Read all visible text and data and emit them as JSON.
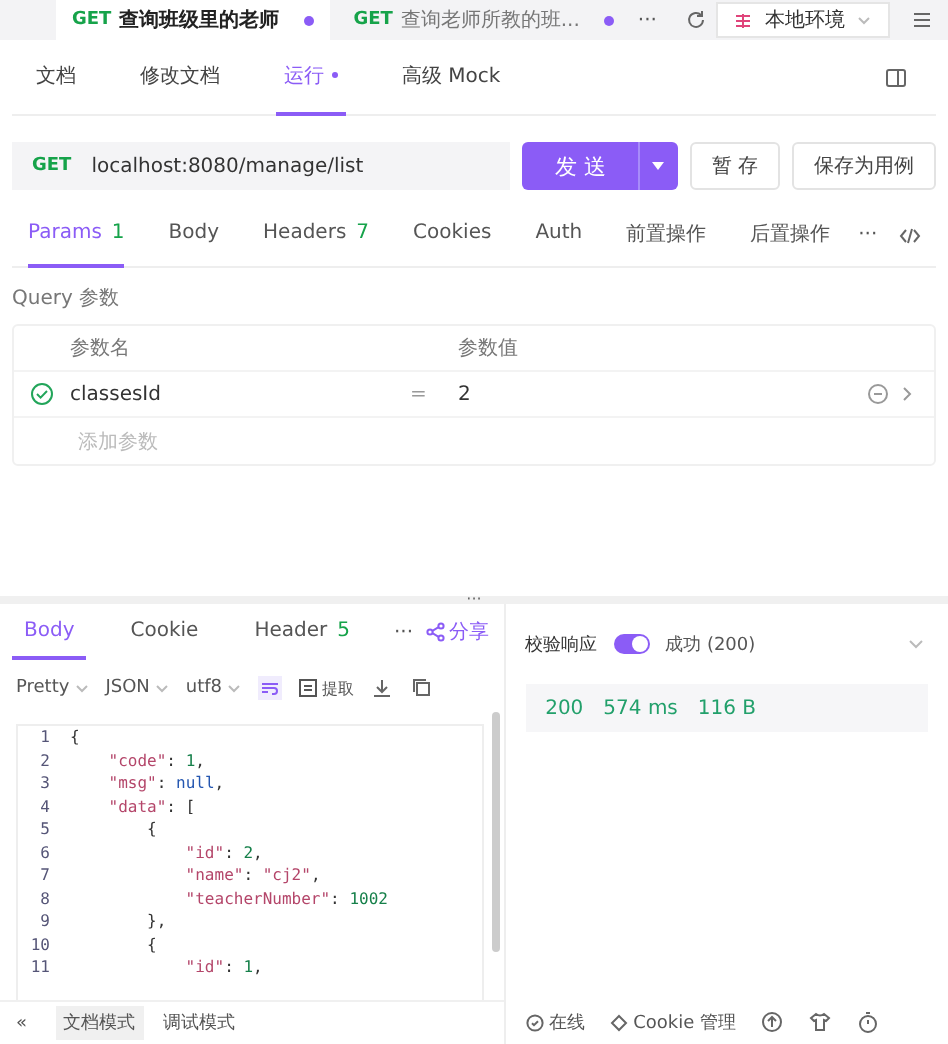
{
  "request_tabs": [
    {
      "method": "GET",
      "title": "查询班级里的老师",
      "selected": true
    },
    {
      "method": "GET",
      "title": "查询老师所教的班...",
      "selected": false
    }
  ],
  "tab_more": "···",
  "environment": "本地环境",
  "view_tabs": [
    {
      "text": "文档",
      "selected": false,
      "dot": false
    },
    {
      "text": "修改文档",
      "selected": false,
      "dot": false
    },
    {
      "text": "运行",
      "selected": true,
      "dot": true
    },
    {
      "text": "高级 Mock",
      "selected": false,
      "dot": false
    }
  ],
  "url_bar": {
    "method": "GET",
    "url": "localhost:8080/manage/list"
  },
  "buttons": {
    "send": "发 送",
    "save": "暂 存",
    "save_case": "保存为用例"
  },
  "param_tabs": [
    {
      "label": "Params",
      "count": "1",
      "selected": true
    },
    {
      "label": "Body",
      "selected": false
    },
    {
      "label": "Headers",
      "count": "7",
      "selected": false
    },
    {
      "label": "Cookies",
      "selected": false
    },
    {
      "label": "Auth",
      "selected": false
    },
    {
      "label": "前置操作",
      "selected": false
    },
    {
      "label": "后置操作",
      "selected": false
    }
  ],
  "param_more": "···",
  "query": {
    "title": "Query 参数",
    "columns": [
      "参数名",
      "参数值"
    ],
    "rows": [
      {
        "name": "classesId",
        "sign": "=",
        "value": "2",
        "checked": true
      }
    ],
    "add_placeholder": "添加参数"
  },
  "splitter": "···",
  "response_tabs": [
    {
      "label": "Body",
      "selected": true
    },
    {
      "label": "Cookie",
      "selected": false
    },
    {
      "label": "Header",
      "count": "5",
      "selected": false
    }
  ],
  "response_more": "···",
  "share": "分享",
  "format_options": [
    "Pretty",
    "JSON",
    "utf8"
  ],
  "extract": "提取",
  "code_lines": [
    {
      "n": "1",
      "text": "{"
    },
    {
      "n": "2",
      "text": "    \"code\": 1,"
    },
    {
      "n": "3",
      "text": "    \"msg\": null,"
    },
    {
      "n": "4",
      "text": "    \"data\": ["
    },
    {
      "n": "5",
      "text": "        {"
    },
    {
      "n": "6",
      "text": "            \"id\": 2,"
    },
    {
      "n": "7",
      "text": "            \"name\": \"cj2\","
    },
    {
      "n": "8",
      "text": "            \"teacherNumber\": 1002"
    },
    {
      "n": "9",
      "text": "        },"
    },
    {
      "n": "10",
      "text": "        {"
    },
    {
      "n": "11",
      "text": "            \"id\": 1,"
    }
  ],
  "validation": {
    "label": "校验响应",
    "on": true,
    "result": "成功 (200)"
  },
  "stats": [
    "200",
    "574 ms",
    "116 B"
  ],
  "footer": {
    "collapse": "«",
    "modes": [
      {
        "label": "文档模式",
        "selected": true
      },
      {
        "label": "调试模式",
        "selected": false
      }
    ],
    "online": "在线",
    "cookie": "Cookie 管理"
  }
}
